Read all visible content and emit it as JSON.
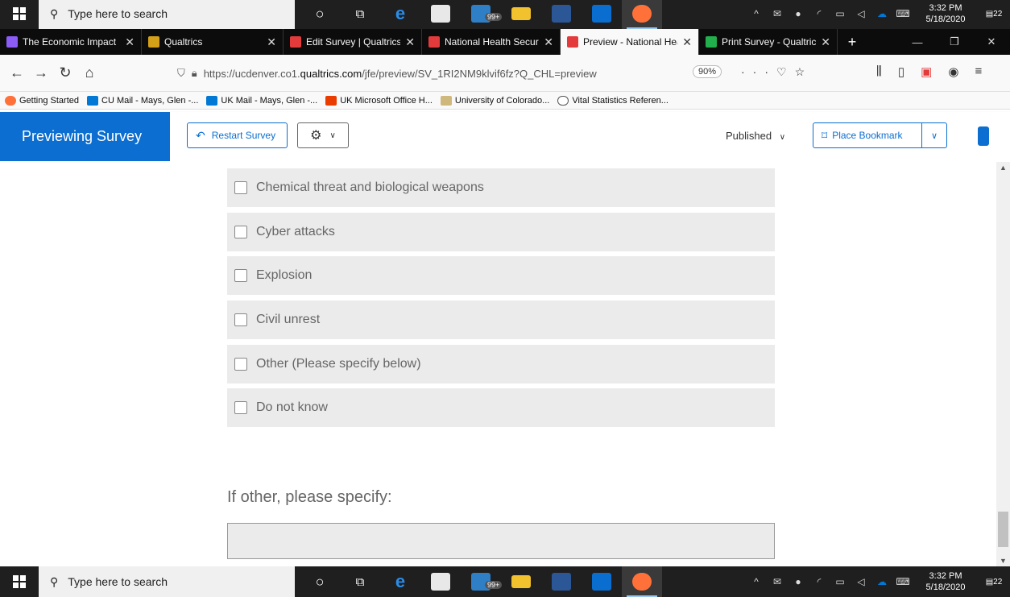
{
  "taskbar_top": {
    "search_placeholder": "Type here to search",
    "time": "3:32 PM",
    "date": "5/18/2020",
    "notif_count": "22",
    "badge": "99+"
  },
  "taskbar_bottom": {
    "search_placeholder": "Type here to search",
    "time": "3:32 PM",
    "date": "5/18/2020",
    "notif_count": "22",
    "badge": "99+"
  },
  "tabs": [
    {
      "title": "The Economic Impact",
      "color": "#8b5cf6"
    },
    {
      "title": "Qualtrics",
      "color": "#d4a017"
    },
    {
      "title": "Edit Survey | Qualtrics",
      "color": "#e33b3b"
    },
    {
      "title": "National Health Secur",
      "color": "#e33b3b"
    },
    {
      "title": "Preview - National Hea",
      "color": "#e33b3b"
    },
    {
      "title": "Print Survey - Qualtric",
      "color": "#21b04b"
    }
  ],
  "url": {
    "prefix": "https://ucdenver.co1.",
    "domain": "qualtrics.com",
    "path": "/jfe/preview/SV_1RI2NM9klvif6fz?Q_CHL=preview",
    "zoom": "90%"
  },
  "bookmarks": [
    {
      "label": "Getting Started",
      "color": "#ff7139"
    },
    {
      "label": "CU Mail - Mays, Glen -...",
      "color": "#0078d4"
    },
    {
      "label": "UK Mail - Mays, Glen -...",
      "color": "#0078d4"
    },
    {
      "label": "UK Microsoft Office H...",
      "color": "#eb3c00"
    },
    {
      "label": "University of Colorado...",
      "color": "#cfb87c"
    },
    {
      "label": "Vital Statistics Referen...",
      "color": "#555555"
    }
  ],
  "header": {
    "title": "Previewing Survey",
    "restart": "Restart Survey",
    "published": "Published",
    "bookmark": "Place Bookmark",
    "accent": "#0b6ed0"
  },
  "options": [
    "Chemical threat and biological weapons",
    "Cyber attacks",
    "Explosion",
    "Civil unrest",
    "Other (Please specify below)",
    "Do not know"
  ],
  "question": "If other, please specify:"
}
